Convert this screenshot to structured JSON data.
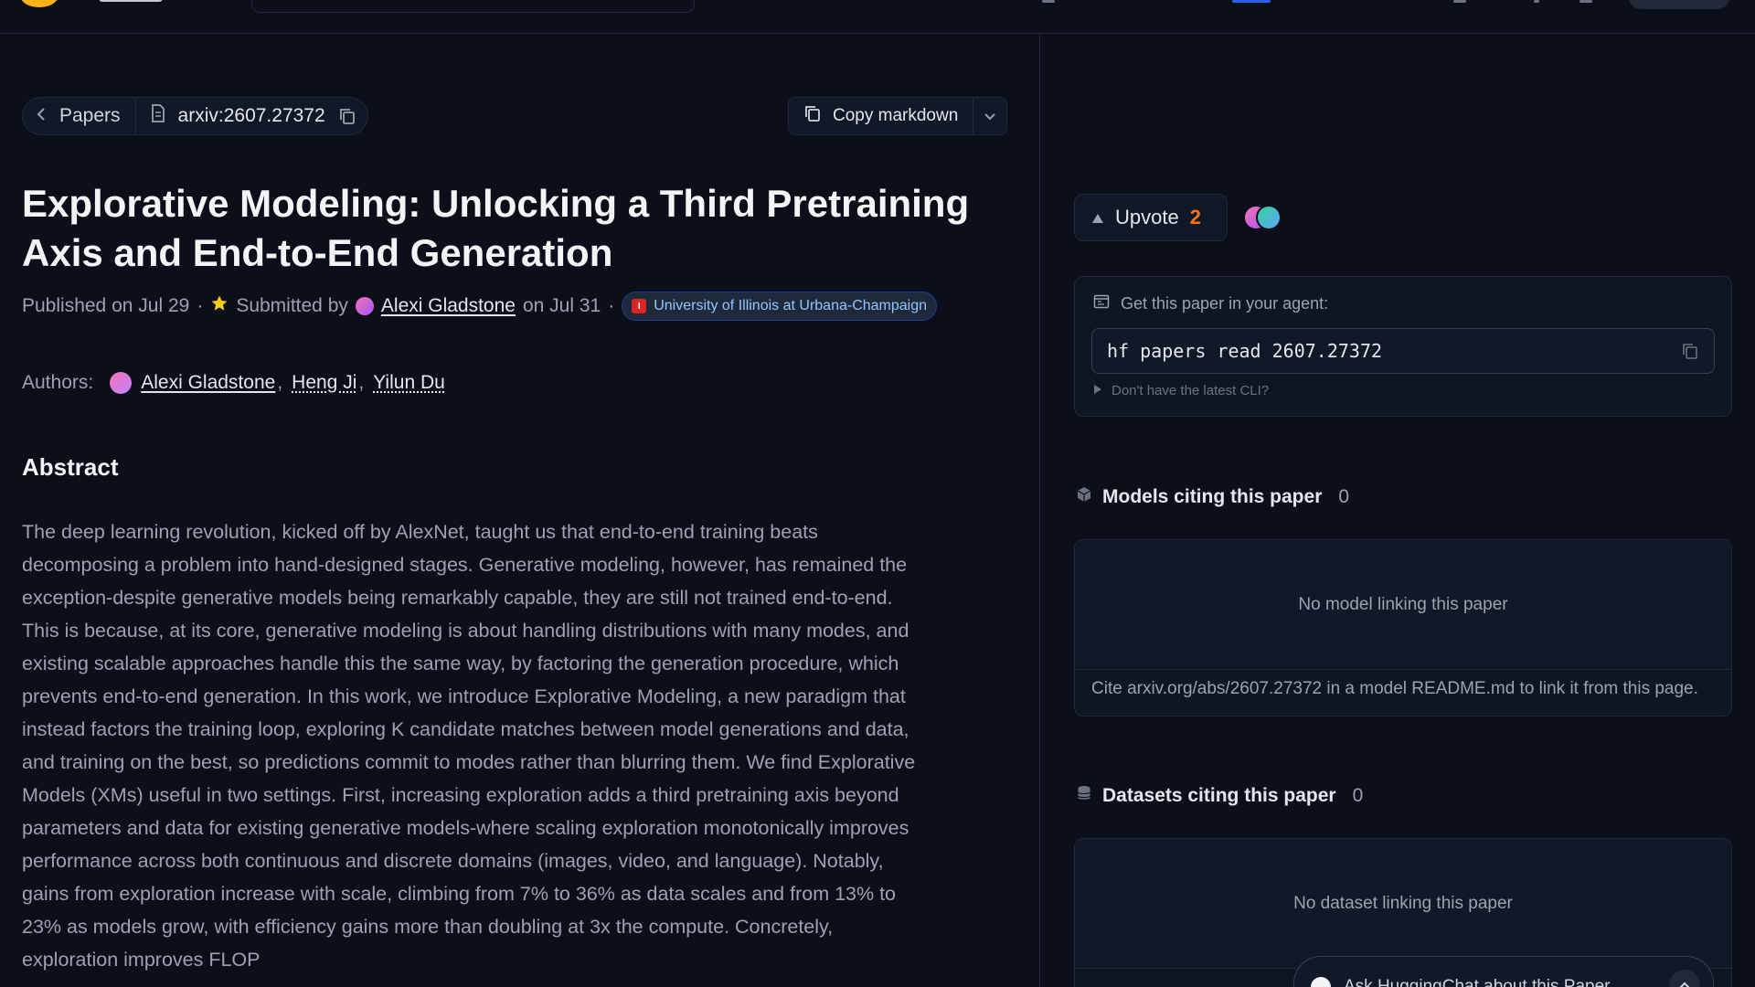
{
  "breadcrumb": {
    "back_label": "Papers",
    "paper_id": "arxiv:2607.27372"
  },
  "actions": {
    "copy_markdown_label": "Copy markdown"
  },
  "paper": {
    "title": "Explorative Modeling: Unlocking a Third Pretraining Axis and End-to-End Generation",
    "published": "Published on Jul 29",
    "submitted_prefix": "Submitted by",
    "submitter": "Alexi Gladstone",
    "submitted_date": "on Jul 31",
    "organization": "University of Illinois at Urbana-Champaign",
    "authors_label": "Authors:",
    "authors": [
      "Alexi Gladstone",
      "Heng Ji",
      "Yilun Du"
    ],
    "abstract_heading": "Abstract",
    "abstract": "The deep learning revolution, kicked off by AlexNet, taught us that end-to-end training beats decomposing a problem into hand-designed stages. Generative modeling, however, has remained the exception-despite generative models being remarkably capable, they are still not trained end-to-end. This is because, at its core, generative modeling is about handling distributions with many modes, and existing scalable approaches handle this the same way, by factoring the generation procedure, which prevents end-to-end generation. In this work, we introduce Explorative Modeling, a new paradigm that instead factors the training loop, exploring K candidate matches between model generations and data, and training on the best, so predictions commit to modes rather than blurring them. We find Explorative Models (XMs) useful in two settings. First, increasing exploration adds a third pretraining axis beyond parameters and data for existing generative models-where scaling exploration monotonically improves performance across both continuous and discrete domains (images, video, and language). Notably, gains from exploration increase with scale, climbing from 7% to 36% as data scales and from 13% to 23% as models grow, with efficiency gains more than doubling at 3x the compute. Concretely, exploration improves FLOP"
  },
  "sidebar": {
    "upvote_label": "Upvote",
    "upvote_count": "2",
    "agent_label": "Get this paper in your agent:",
    "cli_command": "hf papers read 2607.27372",
    "cli_help": "Don't have the latest CLI?",
    "models": {
      "title": "Models citing this paper",
      "count": "0",
      "empty": "No model linking this paper",
      "hint": "Cite arxiv.org/abs/2607.27372 in a model README.md to link it from this page."
    },
    "datasets": {
      "title": "Datasets citing this paper",
      "count": "0",
      "empty": "No dataset linking this paper"
    },
    "chat_label": "Ask HuggingChat about this Paper"
  },
  "colors": {
    "background": "#0b0f19",
    "upvote_count": "#f97316",
    "org_badge_text": "#93c5fd"
  }
}
